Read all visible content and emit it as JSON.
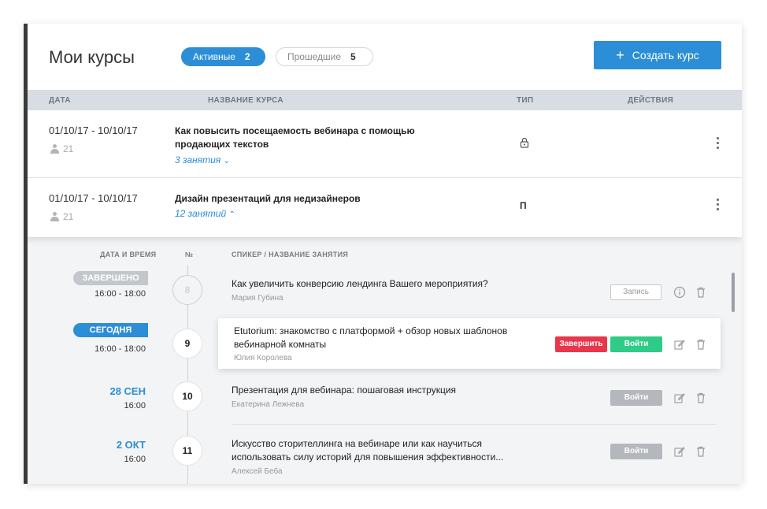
{
  "header": {
    "title": "Мои курсы",
    "tabs": [
      {
        "label": "Активные",
        "count": "2"
      },
      {
        "label": "Прошедшие",
        "count": "5"
      }
    ],
    "create_label": "Создать курс",
    "create_icon": "plus-icon"
  },
  "table": {
    "columns": [
      "ДАТА",
      "НАЗВАНИЕ КУРСА",
      "ТИП",
      "ДЕЙСТВИЯ"
    ]
  },
  "courses": [
    {
      "date": "01/10/17 - 10/10/17",
      "participants": "21",
      "title": "Как повысить посещаемость вебинара с помощью продающих текстов",
      "lessons": "3 занятия",
      "type_icon": "lock-icon",
      "type": ""
    },
    {
      "date": "01/10/17 - 10/10/17",
      "participants": "21",
      "title": "Дизайн презентаций для недизайнеров",
      "lessons": "12 занятий",
      "type": "П"
    }
  ],
  "lessons_table": {
    "columns": [
      "ДАТА И ВРЕМЯ",
      "№",
      "СПИКЕР / НАЗВАНИЕ ЗАНЯТИЯ"
    ],
    "rows": [
      {
        "badge": "ЗАВЕРШЕНО",
        "time": "16:00 - 18:00",
        "number": "8",
        "title": "Как увеличить конверсию лендинга Вашего мероприятия?",
        "speaker": "Мария Губина",
        "action": "Запись"
      },
      {
        "badge": "СЕГОДНЯ",
        "time": "16:00 - 18:00",
        "number": "9",
        "title": "Etutorium: знакомство с платформой + обзор новых шаблонов вебинарной комнаты",
        "speaker": "Юлия Королева",
        "action_finish": "Завершить",
        "action": "Войти"
      },
      {
        "date": "28 СЕН",
        "time": "16:00",
        "number": "10",
        "title": "Презентация для вебинара: пошаговая инструкция",
        "speaker": "Екатерина Лежнева",
        "action": "Войти"
      },
      {
        "date": "2 ОКТ",
        "time": "16:00",
        "number": "11",
        "title": "Искусство сторителлинга на вебинаре или как научиться использовать силу историй для повышения эффективности...",
        "speaker": "Алексей Беба",
        "action": "Войти"
      }
    ]
  },
  "colors": {
    "accent": "#2b8ed6",
    "danger": "#e8364b",
    "success": "#2ecc87",
    "muted_button": "#b4b8bc"
  }
}
